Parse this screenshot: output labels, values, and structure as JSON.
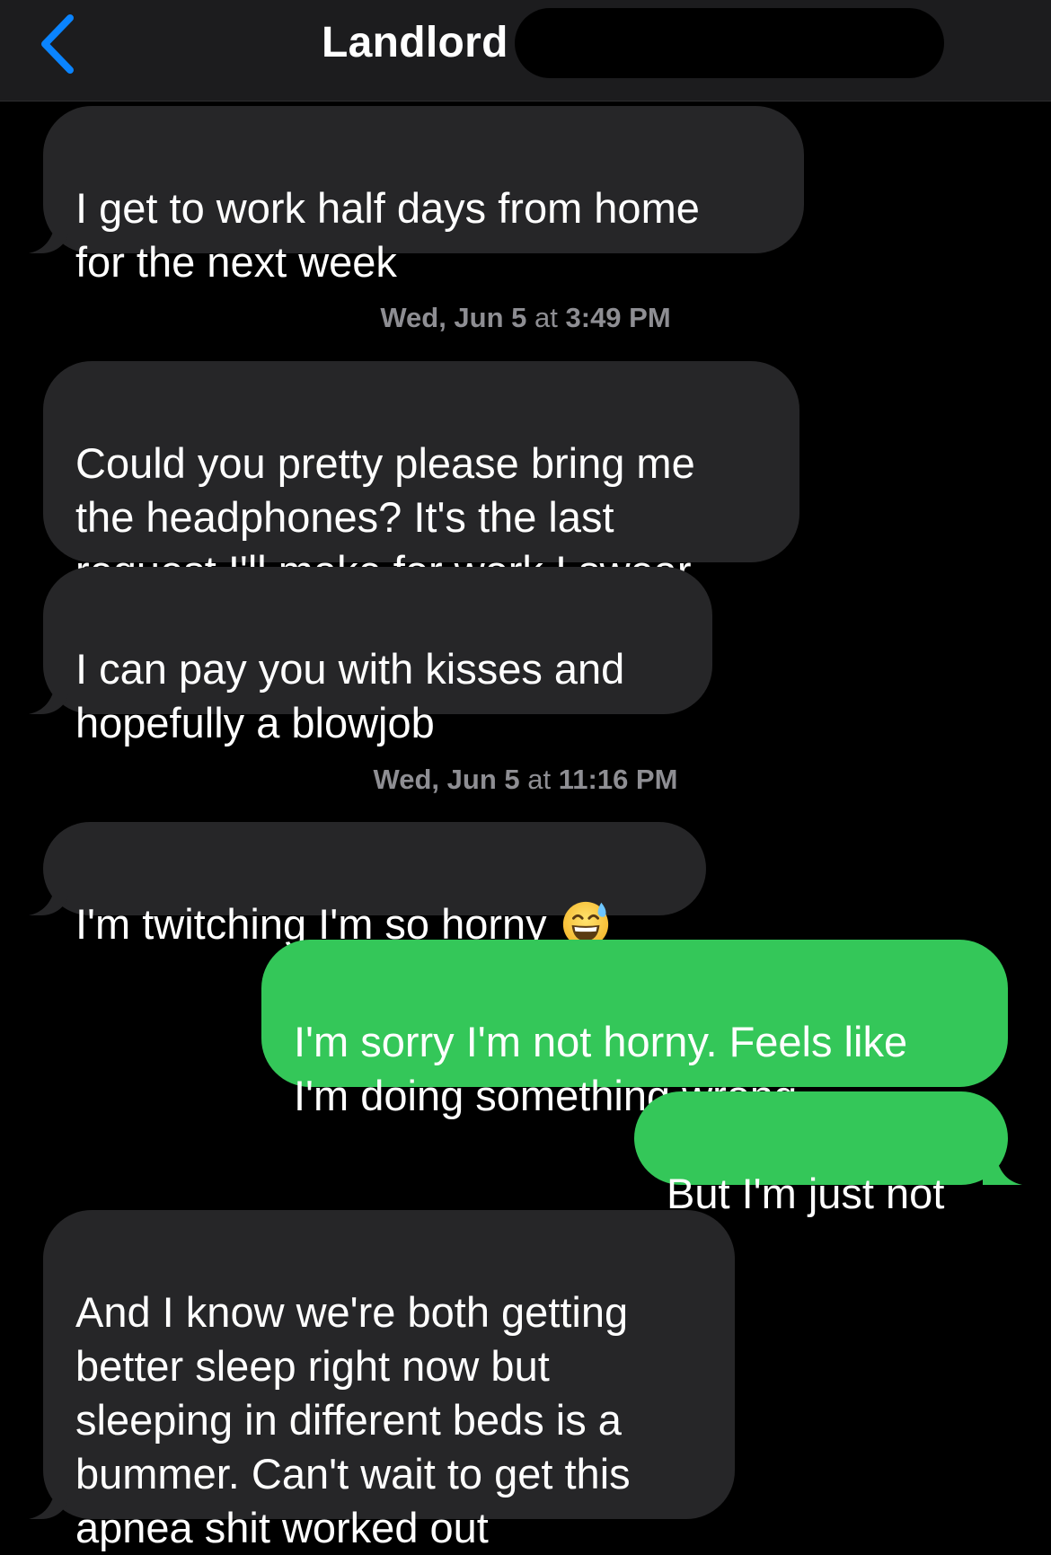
{
  "header": {
    "contact_name": "Landlord"
  },
  "colors": {
    "incoming_bubble": "#262628",
    "outgoing_bubble": "#34c759",
    "accent": "#0a84ff",
    "timestamp_text": "#8e8e93"
  },
  "messages": [
    {
      "direction": "incoming",
      "text": "I get to work half days from home\nfor the next week"
    },
    {
      "direction": "incoming",
      "text": "Could you pretty please bring me\nthe headphones? It's the last\nrequest I'll make for work I swear"
    },
    {
      "direction": "incoming",
      "text": "I can pay you with kisses and\nhopefully a blowjob"
    },
    {
      "direction": "incoming",
      "text": "I'm twitching I'm so horny",
      "emoji": "grinning-sweat-emoji"
    },
    {
      "direction": "outgoing",
      "text": "I'm sorry I'm not horny. Feels like\nI'm doing something wrong"
    },
    {
      "direction": "outgoing",
      "text": "But I'm just not"
    },
    {
      "direction": "incoming",
      "text": "And I know we're both getting\nbetter sleep right now but\nsleeping in different beds is a\nbummer. Can't wait to get this\napnea shit worked out"
    }
  ],
  "timestamps": [
    {
      "day": "Wed, Jun 5",
      "at": "at",
      "time": "3:49 PM"
    },
    {
      "day": "Wed, Jun 5",
      "at": "at",
      "time": "11:16 PM"
    }
  ]
}
